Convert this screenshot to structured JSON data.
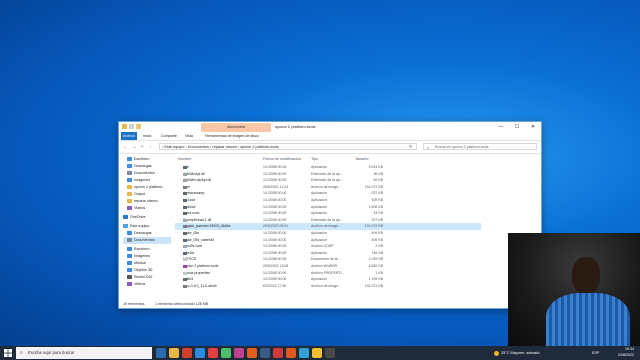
{
  "window": {
    "context_tab": "Administrar",
    "title": "opcion 2 platform-tools",
    "controls": [
      "—",
      "☐",
      "✕"
    ]
  },
  "ribbon": {
    "tabs": [
      "Archivo",
      "Inicio",
      "Compartir",
      "Vista",
      "Herramientas de imagen de disco"
    ]
  },
  "address": {
    "path": "›  Este equipo  ›  Documentos  ›  reparar xiaomi  ›  opcion 2 platform-tools",
    "search_placeholder": "Buscar en opcion 2 platform-tools"
  },
  "nav": {
    "items": [
      {
        "label": "Escritorio",
        "color": "#3c8fe0"
      },
      {
        "label": "Descargas",
        "color": "#3c8fe0"
      },
      {
        "label": "Documentos",
        "color": "#7a8aa0"
      },
      {
        "label": "Imágenes",
        "color": "#3c8fe0"
      },
      {
        "label": "opcion 2 platform-",
        "color": "#e8b84a"
      },
      {
        "label": "Output",
        "color": "#e8b84a"
      },
      {
        "label": "reparar xiaomi",
        "color": "#e8b84a"
      },
      {
        "label": "Videos",
        "color": "#8a5cc8"
      },
      {
        "label": "OneDrive",
        "color": "#2a78d0"
      },
      {
        "label": "Este equipo",
        "color": "#4aa0e8"
      },
      {
        "label": "Descargas",
        "color": "#3c8fe0"
      },
      {
        "label": "Documentos",
        "color": "#7a8aa0"
      },
      {
        "label": "Escritorio",
        "color": "#3c8fe0"
      },
      {
        "label": "Imágenes",
        "color": "#3c8fe0"
      },
      {
        "label": "Música",
        "color": "#3c8fe0"
      },
      {
        "label": "Objetos 3D",
        "color": "#3c8fe0"
      },
      {
        "label": "Redmi K40",
        "color": "#555555"
      },
      {
        "label": "Videos",
        "color": "#8a5cc8"
      }
    ]
  },
  "columns": {
    "name": "Nombre",
    "date": "Fecha de modificación",
    "type": "Tipo",
    "size": "Tamaño"
  },
  "files": [
    {
      "name": "adb",
      "date": "1/1/2008 00:00",
      "type": "Aplicación",
      "size": "5.914 KB",
      "color": "#5a6a7a"
    },
    {
      "name": "AdbWinApi.dll",
      "date": "1/1/2008 00:00",
      "type": "Extensión de la ap...",
      "size": "96 KB",
      "color": "#9aa6b2"
    },
    {
      "name": "AdbWinUsbApi.dll",
      "date": "1/1/2008 00:00",
      "type": "Extensión de la ap...",
      "size": "62 KB",
      "color": "#9aa6b2"
    },
    {
      "name": "boot",
      "date": "26/5/2022 11:24",
      "type": "Archivo de image...",
      "size": "131.072 KB",
      "color": "#7a7a7a"
    },
    {
      "name": "dmtracedump",
      "date": "1/1/2008 00:00",
      "type": "Aplicación",
      "size": "237 KB",
      "color": "#5a6a7a"
    },
    {
      "name": "etc1tool",
      "date": "1/1/2008 00:00",
      "type": "Aplicación",
      "size": "409 KB",
      "color": "#5a6a7a"
    },
    {
      "name": "fastboot",
      "date": "1/1/2008 00:00",
      "type": "Aplicación",
      "size": "1.606 KB",
      "color": "#5a6a7a"
    },
    {
      "name": "hprof-conv",
      "date": "1/1/2008 00:00",
      "type": "Aplicación",
      "size": "43 KB",
      "color": "#5a6a7a"
    },
    {
      "name": "libwinpthread-1.dll",
      "date": "1/1/2008 00:00",
      "type": "Extensión de la ap...",
      "size": "227 KB",
      "color": "#9aa6b2"
    },
    {
      "name": "magisk_patched-25200_8k6ks",
      "date": "26/5/2022 06:51",
      "type": "Archivo de image...",
      "size": "131.072 KB",
      "color": "#7a7a7a",
      "selected": true
    },
    {
      "name": "make_f2fs",
      "date": "1/1/2008 00:00",
      "type": "Aplicación",
      "size": "409 KB",
      "color": "#5a6a7a"
    },
    {
      "name": "make_f2fs_casefold",
      "date": "1/1/2008 00:00",
      "type": "Aplicación",
      "size": "409 KB",
      "color": "#5a6a7a"
    },
    {
      "name": "mke2fs.conf",
      "date": "1/1/2008 00:00",
      "type": "Archivo CONF",
      "size": "2 KB",
      "color": "#9aa6b2"
    },
    {
      "name": "mke2fs",
      "date": "1/1/2008 00:00",
      "type": "Aplicación",
      "size": "746 KB",
      "color": "#5a6a7a"
    },
    {
      "name": "NOTICE",
      "date": "1/1/2008 00:00",
      "type": "Documento de te...",
      "size": "2.749 KB",
      "color": "#c0c8d0"
    },
    {
      "name": "opcion 2 platform-tools",
      "date": "26/5/2022 13:08",
      "type": "Archivo WinRAR",
      "size": "6.552 KB",
      "color": "#a040a0"
    },
    {
      "name": "source.properties",
      "date": "1/1/2008 00:00",
      "type": "Archivo PROPERTI...",
      "size": "1 KB",
      "color": "#c0c8d0"
    },
    {
      "name": "sqlite3",
      "date": "1/1/2008 00:00",
      "type": "Aplicación",
      "size": "1.199 KB",
      "color": "#5a6a7a"
    },
    {
      "name": "twrp-3.6.0_11-0-alioth",
      "date": "6/3/2022 17:50",
      "type": "Archivo de image...",
      "size": "131.072 KB",
      "color": "#7a7a7a"
    }
  ],
  "status": {
    "count": "19 elementos",
    "selection": "1 elemento seleccionado  128 MB"
  },
  "taskbar": {
    "search_placeholder": "Escribe aquí para buscar",
    "weather": "25°C  Mayorm. soleado",
    "lang": "ESP",
    "time": "19:34",
    "date": "24/8/2022",
    "app_colors": [
      "#2b6cb0",
      "#e8b84a",
      "#d04030",
      "#2a8ae0",
      "#e04040",
      "#4cc06a",
      "#c04090",
      "#e06020",
      "#3a5a8a",
      "#d03a3a",
      "#e05a20",
      "#30a0d0",
      "#f0c030",
      "#4a4a4a"
    ]
  }
}
